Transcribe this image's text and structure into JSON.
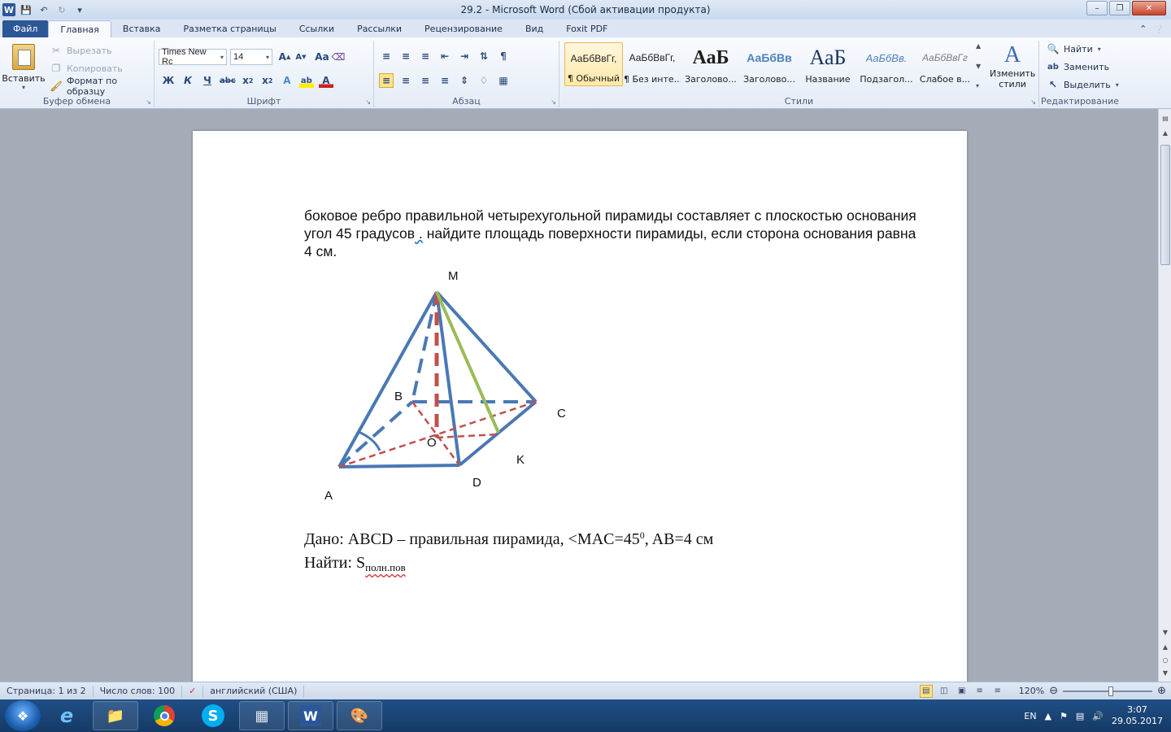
{
  "window": {
    "title": "29.2  -  Microsoft Word (Сбой активации продукта)",
    "app_icon": "W"
  },
  "qat": {
    "icons": [
      "save-icon",
      "undo-icon",
      "redo-icon",
      "customize-icon"
    ]
  },
  "tabs": [
    {
      "label": "Файл",
      "kind": "file"
    },
    {
      "label": "Главная",
      "kind": "active"
    },
    {
      "label": "Вставка"
    },
    {
      "label": "Разметка страницы"
    },
    {
      "label": "Ссылки"
    },
    {
      "label": "Рассылки"
    },
    {
      "label": "Рецензирование"
    },
    {
      "label": "Вид"
    },
    {
      "label": "Foxit PDF"
    }
  ],
  "clipboard": {
    "label": "Буфер обмена",
    "paste": "Вставить",
    "cut": "Вырезать",
    "copy": "Копировать",
    "format_painter": "Формат по образцу"
  },
  "font": {
    "label": "Шрифт",
    "name": "Times New Rc",
    "size": "14"
  },
  "paragraph": {
    "label": "Абзац"
  },
  "styles": {
    "label": "Стили",
    "items": [
      {
        "sample": "АаБбВвГг,",
        "name": "¶ Обычный"
      },
      {
        "sample": "АаБбВвГг,",
        "name": "¶ Без инте..."
      },
      {
        "sample": "АаБ",
        "name": "Заголово..."
      },
      {
        "sample": "АаБбВв",
        "name": "Заголово..."
      },
      {
        "sample": "АаБ",
        "name": "Название"
      },
      {
        "sample": "АаБбВв.",
        "name": "Подзагол..."
      },
      {
        "sample": "АаБбВвГг",
        "name": "Слабое в..."
      }
    ],
    "change": "Изменить стили"
  },
  "editing": {
    "label": "Редактирование",
    "find": "Найти",
    "replace": "Заменить",
    "select": "Выделить"
  },
  "document": {
    "para_part1": "боковое ребро правильной четырехугольной пирамиды составляет с плоскостью основания угол 45 градусов",
    "para_comma": " .",
    "para_part2": " найдите площадь поверхности пирамиды, если сторона основания равна 4 см.",
    "given_prefix": "Дано: ABCD – правильная пирамида, <MAC=45",
    "given_sup": "0",
    "given_suffix": ", AB=4 см",
    "find_prefix": "Найти: S",
    "find_sub": "полн.пов"
  },
  "figure": {
    "labels": {
      "M": "M",
      "B": "B",
      "C": "C",
      "O": "O",
      "K": "K",
      "A": "A",
      "D": "D"
    },
    "colors": {
      "edge": "#4a78b5",
      "height": "#c0504d",
      "apothem": "#9bbb59"
    }
  },
  "status": {
    "page": "Страница: 1 из 2",
    "words": "Число слов: 100",
    "language": "английский (США)",
    "zoom": "120%",
    "zoom_level": 0.54
  },
  "taskbar": {
    "apps": [
      "ie-icon",
      "explorer-icon",
      "chrome-icon",
      "skype-icon",
      "calculator-icon",
      "word-icon",
      "paint-icon"
    ],
    "lang": "EN",
    "time": "3:07",
    "date": "29.05.2017"
  }
}
